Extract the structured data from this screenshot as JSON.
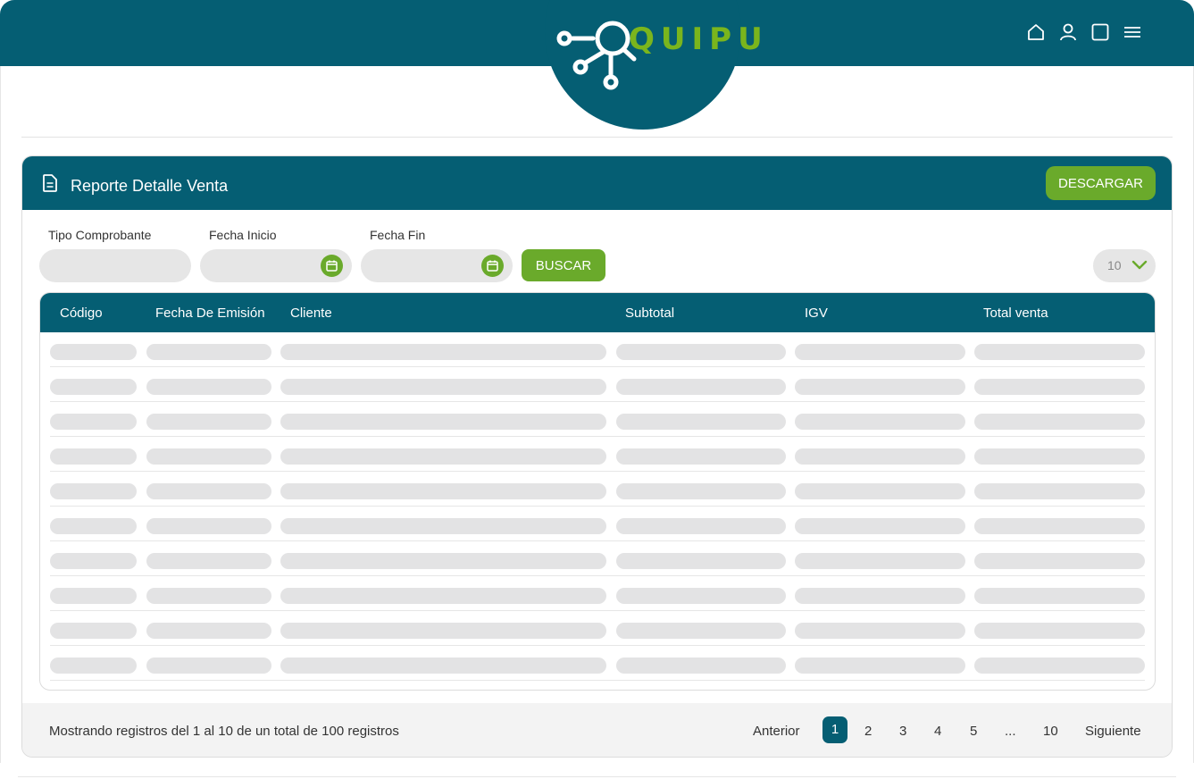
{
  "brand": {
    "name": "QUIPU",
    "accent": "#7ab51d",
    "primary": "#055e73"
  },
  "header": {
    "icons": [
      "home-icon",
      "user-icon",
      "window-icon",
      "menu-icon"
    ]
  },
  "report": {
    "title": "Reporte Detalle Venta",
    "download_label": "DESCARGAR"
  },
  "filters": {
    "tipo_label": "Tipo Comprobante",
    "tipo_value": "",
    "inicio_label": "Fecha Inicio",
    "inicio_value": "",
    "fin_label": "Fecha Fin",
    "fin_value": "",
    "search_label": "BUSCAR",
    "page_size": "10"
  },
  "table": {
    "columns": [
      "Código",
      "Fecha De Emisión",
      "Cliente",
      "Subtotal",
      "IGV",
      "Total venta"
    ],
    "rows_loading": 10
  },
  "footer": {
    "info": "Mostrando registros del 1 al 10 de un total de 100 registros",
    "prev": "Anterior",
    "next": "Siguiente",
    "pages": [
      "1",
      "2",
      "3",
      "4",
      "5",
      "...",
      "10"
    ],
    "current_page": "1"
  }
}
